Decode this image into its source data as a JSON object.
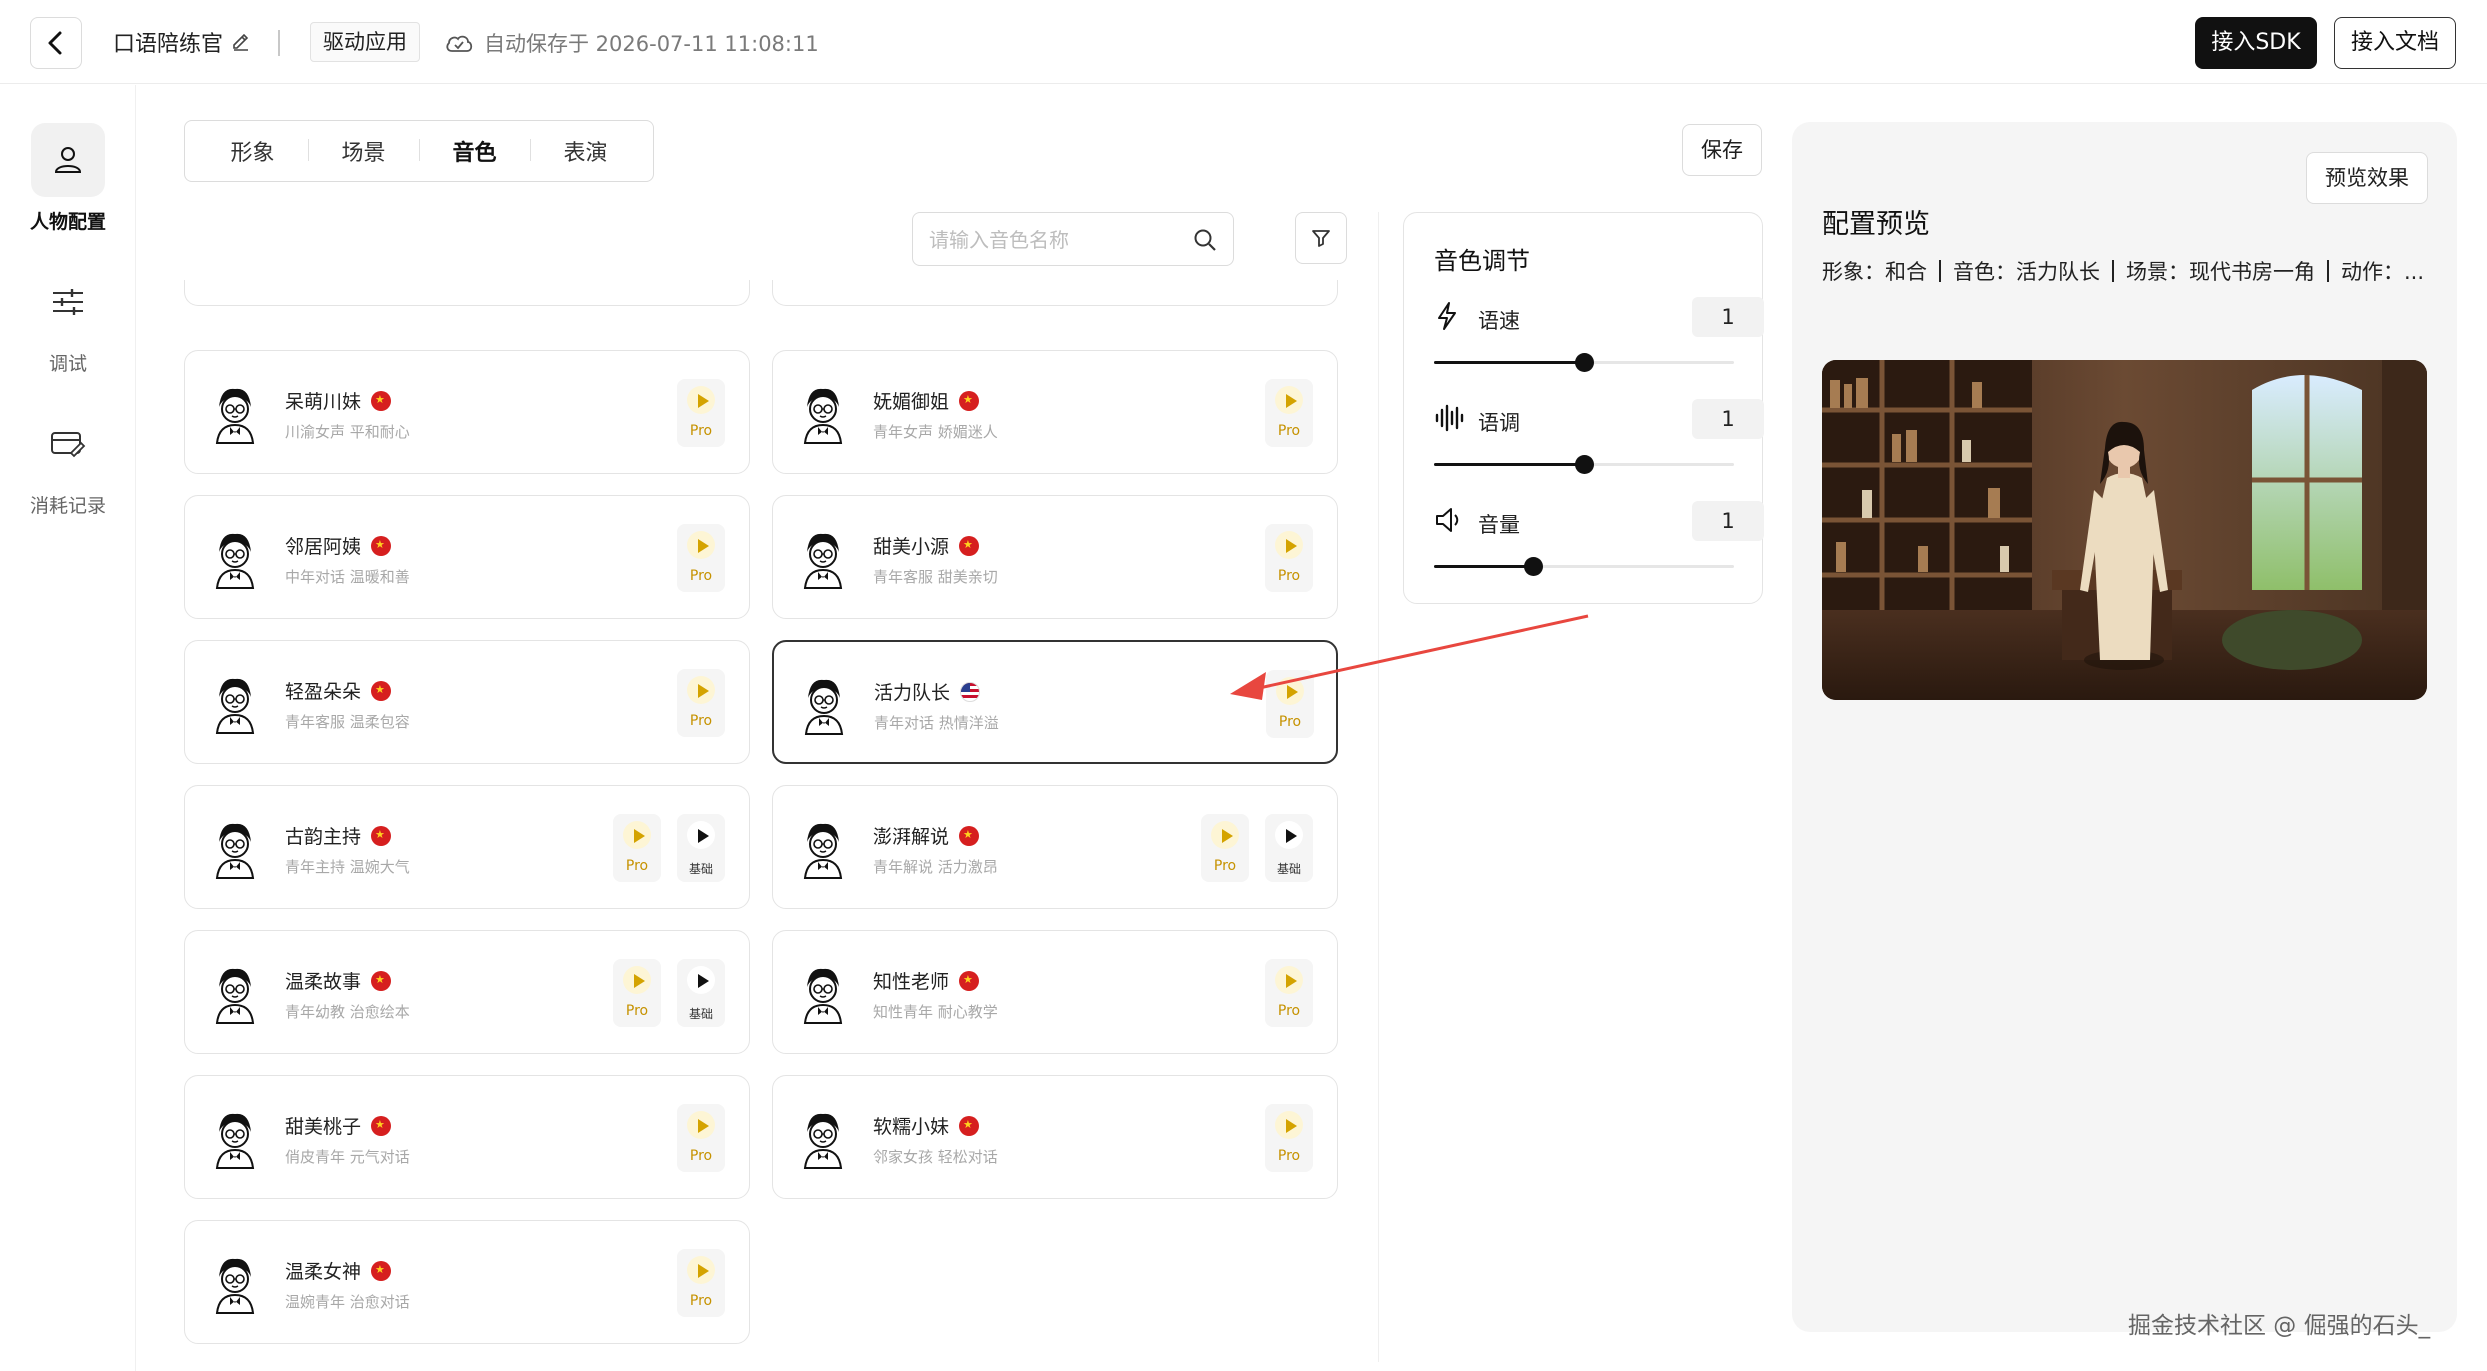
{
  "header": {
    "app_title": "口语陪练官",
    "drive_tag": "驱动应用",
    "autosave_text": "自动保存于 2026-07-11 11:08:11",
    "sdk_label": "接入SDK",
    "doc_label": "接入文档"
  },
  "nav": {
    "items": [
      {
        "label": "人物配置",
        "icon": "person-icon",
        "active": true
      },
      {
        "label": "调试",
        "icon": "sliders-icon",
        "active": false
      },
      {
        "label": "消耗记录",
        "icon": "card-edit-icon",
        "active": false
      }
    ]
  },
  "tabs": [
    {
      "label": "形象",
      "active": false
    },
    {
      "label": "场景",
      "active": false
    },
    {
      "label": "音色",
      "active": true
    },
    {
      "label": "表演",
      "active": false
    }
  ],
  "toolbar": {
    "save_label": "保存"
  },
  "search": {
    "placeholder": "请输入音色名称",
    "value": ""
  },
  "voices": [
    {
      "name": "呆萌川妹",
      "desc": "川渝女声 平和耐心",
      "flag": "cn",
      "pro": "Pro"
    },
    {
      "name": "妩媚御姐",
      "desc": "青年女声 娇媚迷人",
      "flag": "cn",
      "pro": "Pro"
    },
    {
      "name": "邻居阿姨",
      "desc": "中年对话 温暖和善",
      "flag": "cn",
      "pro": "Pro"
    },
    {
      "name": "甜美小源",
      "desc": "青年客服 甜美亲切",
      "flag": "cn",
      "pro": "Pro"
    },
    {
      "name": "轻盈朵朵",
      "desc": "青年客服 温柔包容",
      "flag": "cn",
      "pro": "Pro"
    },
    {
      "name": "活力队长",
      "desc": "青年对话 热情洋溢",
      "flag": "us",
      "pro": "Pro",
      "selected": true
    },
    {
      "name": "古韵主持",
      "desc": "青年主持 温婉大气",
      "flag": "cn",
      "pro": "Pro",
      "basic": "基础"
    },
    {
      "name": "澎湃解说",
      "desc": "青年解说 活力激昂",
      "flag": "cn",
      "pro": "Pro",
      "basic": "基础"
    },
    {
      "name": "温柔故事",
      "desc": "青年幼教 治愈绘本",
      "flag": "cn",
      "pro": "Pro",
      "basic": "基础"
    },
    {
      "name": "知性老师",
      "desc": "知性青年 耐心教学",
      "flag": "cn",
      "pro": "Pro"
    },
    {
      "name": "甜美桃子",
      "desc": "俏皮青年 元气对话",
      "flag": "cn",
      "pro": "Pro"
    },
    {
      "name": "软糯小妹",
      "desc": "邻家女孩 轻松对话",
      "flag": "cn",
      "pro": "Pro"
    },
    {
      "name": "温柔女神",
      "desc": "温婉青年 治愈对话",
      "flag": "cn",
      "pro": "Pro"
    }
  ],
  "tone": {
    "title": "音色调节",
    "rows": [
      {
        "label": "语速",
        "value": "1",
        "level": 0.5,
        "icon": "lightning-icon"
      },
      {
        "label": "语调",
        "value": "1",
        "level": 0.5,
        "icon": "waveform-icon"
      },
      {
        "label": "音量",
        "value": "1",
        "level": 0.33,
        "icon": "speaker-icon"
      }
    ]
  },
  "preview": {
    "title": "配置预览",
    "button_label": "预览效果",
    "summary": [
      "形象：和合",
      "音色：活力队长",
      "场景：现代书房一角",
      "动作：..."
    ]
  },
  "watermark": "掘金技术社区 @ 倔强的石头_",
  "colors": {
    "primary": "#111111",
    "pro_gold": "#d4a300",
    "arrow_red": "#e8473f"
  }
}
